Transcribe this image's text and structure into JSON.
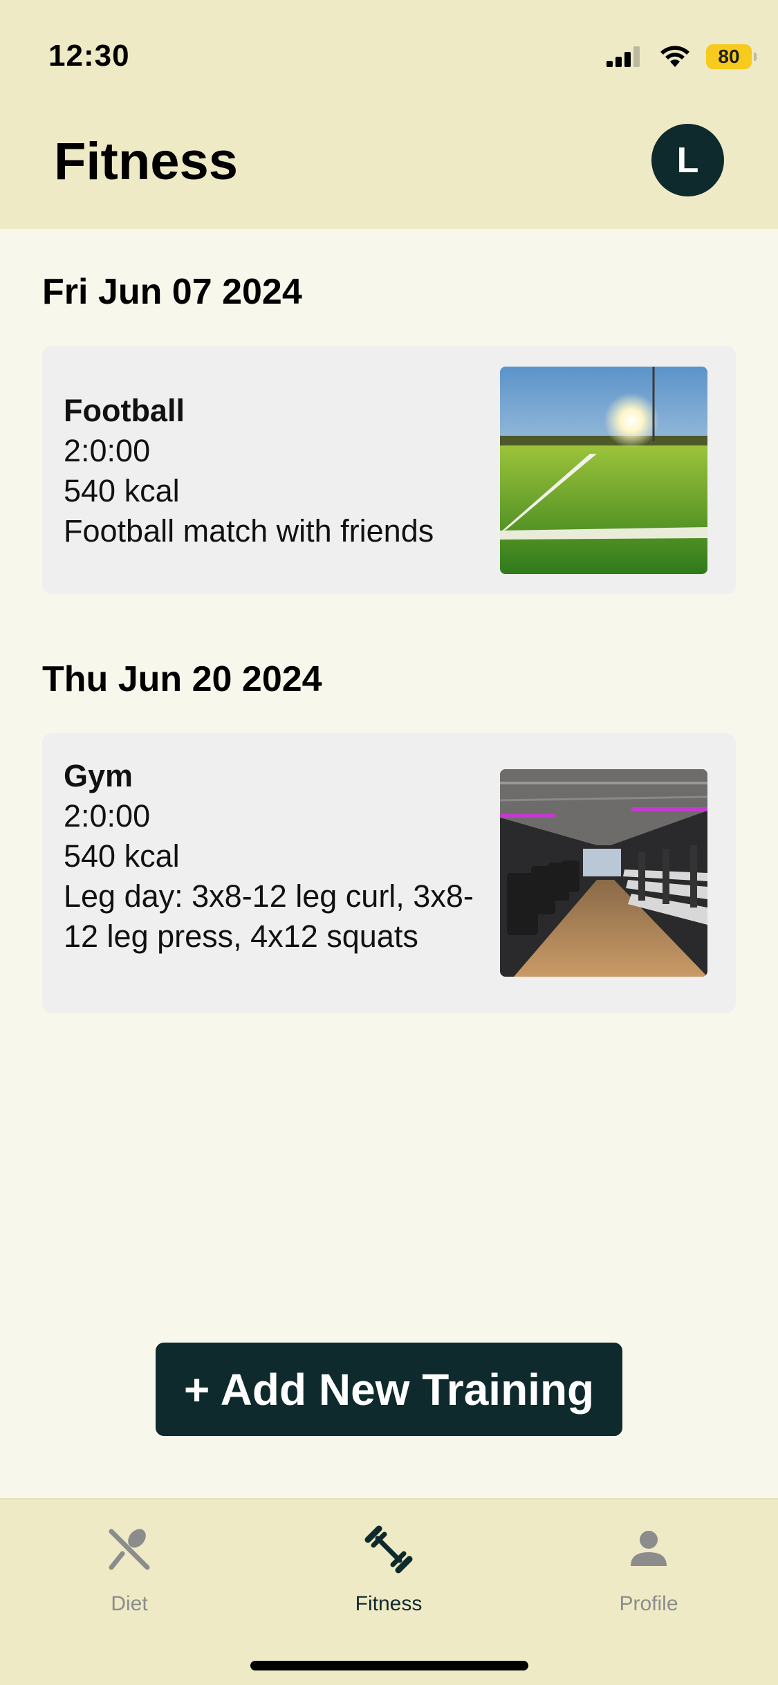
{
  "status_bar": {
    "time": "12:30",
    "battery": "80",
    "icons": [
      "signal-icon",
      "wifi-icon",
      "battery-icon"
    ]
  },
  "header": {
    "title": "Fitness",
    "avatar_initial": "L"
  },
  "entries": [
    {
      "date": "Fri Jun 07 2024",
      "title": "Football",
      "duration": "2:0:00",
      "calories": "540 kcal",
      "note": "Football match with friends",
      "image": "football-field-photo"
    },
    {
      "date": "Thu Jun 20 2024",
      "title": "Gym",
      "duration": "2:0:00",
      "calories": "540 kcal",
      "note": "Leg day: 3x8-12 leg curl, 3x8-12 leg press, 4x12 squats",
      "image": "gym-treadmills-photo"
    }
  ],
  "add_button_label": "+ Add New Training",
  "tabs": [
    {
      "label": "Diet",
      "icon": "fork-spoon-icon",
      "active": false
    },
    {
      "label": "Fitness",
      "icon": "dumbbell-icon",
      "active": true
    },
    {
      "label": "Profile",
      "icon": "person-icon",
      "active": false
    }
  ],
  "colors": {
    "header_bg": "#eeeac6",
    "page_bg": "#f8f7ec",
    "card_bg": "#efefef",
    "accent_dark": "#0e2a2c",
    "battery": "#f7ca1e",
    "inactive_tab": "#8c8c8c"
  }
}
